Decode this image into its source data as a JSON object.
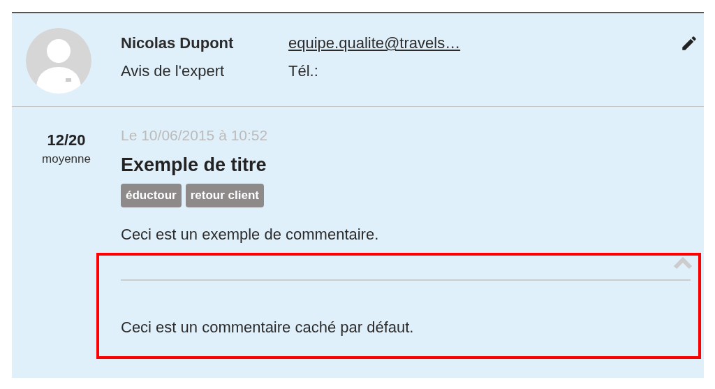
{
  "author": {
    "name": "Nicolas Dupont",
    "role": "Avis de l'expert",
    "email": "equipe.qualite@travels…",
    "phone_label": "Tél.:"
  },
  "review": {
    "score": "12/20",
    "score_label": "moyenne",
    "date": "Le 10/06/2015 à 10:52",
    "title": "Exemple de titre",
    "tags": [
      "éductour",
      "retour client"
    ],
    "comment": "Ceci est un exemple de commentaire.",
    "hidden_comment": {
      "expanded": true,
      "text": "Ceci est un commentaire caché par défaut."
    }
  }
}
